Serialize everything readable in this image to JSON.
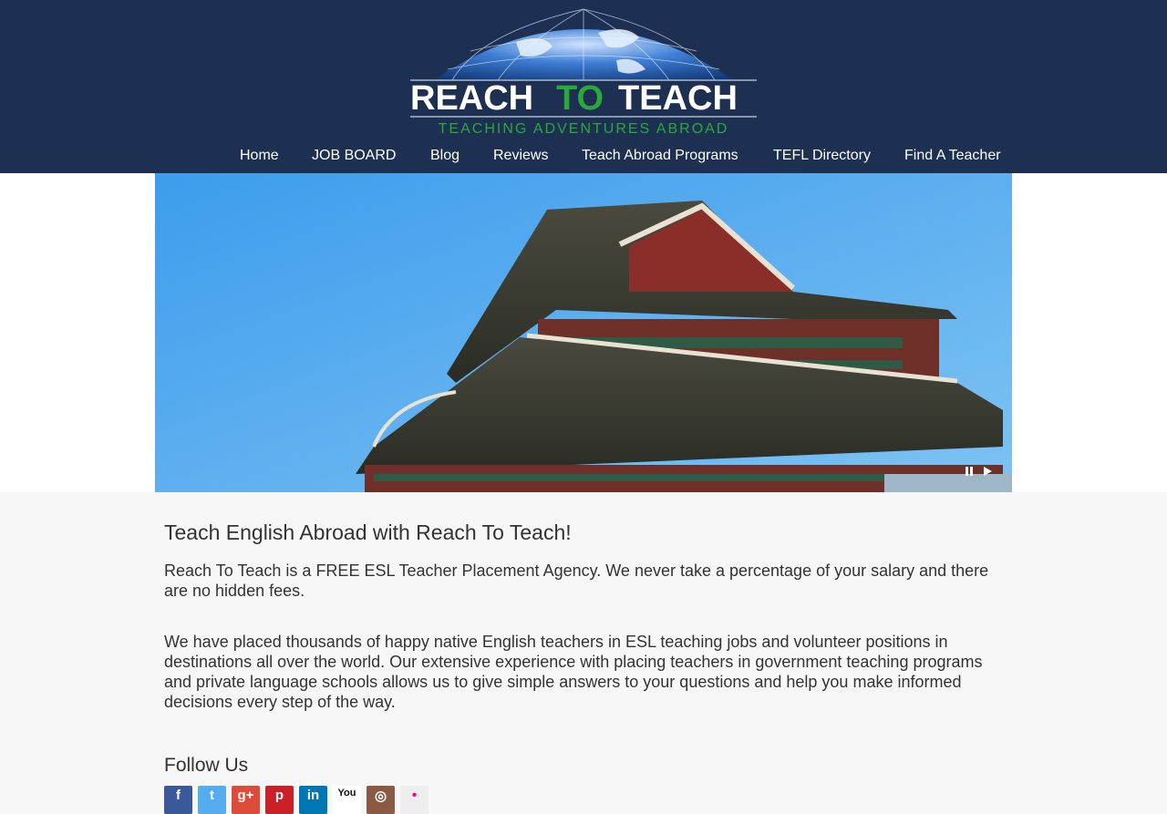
{
  "logo": {
    "word1": "REACH",
    "word2": "TO",
    "word3": "TEACH",
    "tagline": "TEACHING ADVENTURES ABROAD"
  },
  "nav": {
    "items": [
      {
        "label": "Home"
      },
      {
        "label": "JOB BOARD"
      },
      {
        "label": "Blog"
      },
      {
        "label": "Reviews"
      },
      {
        "label": "Teach Abroad Programs"
      },
      {
        "label": "TEFL Directory"
      },
      {
        "label": "Find A Teacher"
      }
    ]
  },
  "hero": {
    "pause_icon": "pause-icon",
    "play_icon": "play-icon"
  },
  "main": {
    "title": "Teach English Abroad with Reach To Teach!",
    "intro": "Reach To Teach is a FREE ESL Teacher Placement Agency. We never take a percentage of your salary and there are no hidden fees.",
    "body": "We have placed thousands of happy native English teachers in ESL teaching jobs and volunteer positions in destinations all over the world. Our extensive experience with placing teachers in government teaching programs and private language schools allows us to give simple answers to your questions and help you make informed decisions every step of the way.",
    "follow_heading": "Follow Us"
  },
  "social": [
    {
      "name": "facebook-icon",
      "glyph": "f",
      "color": "#3b5998"
    },
    {
      "name": "twitter-icon",
      "glyph": "t",
      "color": "#55acee"
    },
    {
      "name": "google-plus-icon",
      "glyph": "g+",
      "color": "#dd4b39"
    },
    {
      "name": "pinterest-icon",
      "glyph": "p",
      "color": "#cb2027"
    },
    {
      "name": "linkedin-icon",
      "glyph": "in",
      "color": "#0077b5"
    },
    {
      "name": "youtube-icon",
      "glyph": "You",
      "color": "#ffffff"
    },
    {
      "name": "instagram-icon",
      "glyph": "◎",
      "color": "#8a5a44"
    },
    {
      "name": "flickr-icon",
      "glyph": "•",
      "color": "#eeeeee"
    }
  ],
  "colors": {
    "header_bg": "#1d3052",
    "logo_green": "#2aa83b",
    "page_bg": "#f7f7f7"
  }
}
